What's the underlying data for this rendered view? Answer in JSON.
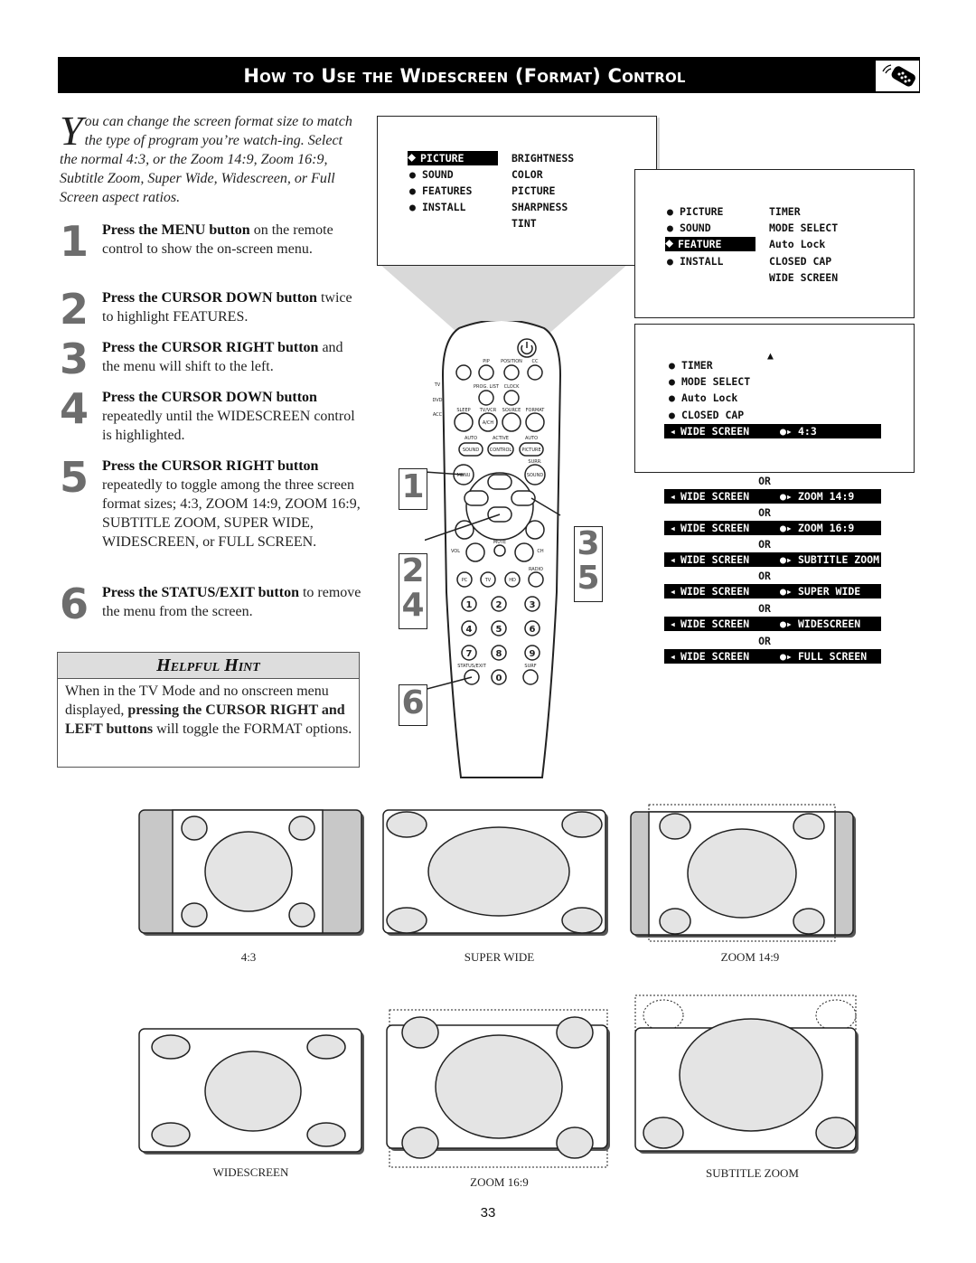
{
  "header": {
    "title": "How to Use the Widescreen (Format) Control",
    "icon": "remote-control-icon"
  },
  "intro": {
    "dropcap": "Y",
    "text": "ou can change the screen format size to match the type of program you’re watch-ing. Select the normal 4:3, or the Zoom 14:9, Zoom 16:9, Subtitle Zoom, Super Wide, Widescreen, or Full Screen aspect ratios."
  },
  "steps": [
    {
      "number": "1",
      "bold": "Press the MENU button",
      "rest": " on the remote control to show the on-screen menu."
    },
    {
      "number": "2",
      "bold": "Press the CURSOR DOWN button",
      "rest": " twice to highlight FEATURES."
    },
    {
      "number": "3",
      "bold": "Press the CURSOR RIGHT button",
      "rest": " and the menu will shift to the left."
    },
    {
      "number": "4",
      "bold": "Press the CURSOR DOWN button",
      "rest": " repeatedly until the WIDESCREEN control is highlighted."
    },
    {
      "number": "5",
      "bold": "Press the CURSOR RIGHT button",
      "rest": " repeatedly to toggle among the three screen format sizes; 4:3, ZOOM 14:9, ZOOM 16:9, SUBTITLE ZOOM, SUPER WIDE, WIDESCREEN, or FULL SCREEN."
    },
    {
      "number": "6",
      "bold": "Press the STATUS/EXIT button",
      "rest": " to remove the menu from the screen."
    }
  ],
  "hint": {
    "title": "Helpful Hint",
    "text_before": "When in the TV Mode and no onscreen menu displayed, ",
    "bold": "pressing the CURSOR RIGHT and LEFT buttons",
    "text_after": " will toggle the FORMAT options."
  },
  "menu1": {
    "left": [
      "PICTURE",
      "SOUND",
      "FEATURES",
      "INSTALL"
    ],
    "right": [
      "BRIGHTNESS",
      "COLOR",
      "PICTURE",
      "SHARPNESS",
      "TINT"
    ],
    "highlighted": "PICTURE"
  },
  "menu2": {
    "left": [
      "PICTURE",
      "SOUND",
      "FEATURE",
      "INSTALL"
    ],
    "right": [
      "TIMER",
      "MODE SELECT",
      "Auto Lock",
      "CLOSED CAP",
      "WIDE SCREEN"
    ],
    "highlighted": "FEATURE"
  },
  "menu3": {
    "items": [
      "TIMER",
      "MODE SELECT",
      "Auto Lock",
      "CLOSED CAP"
    ],
    "selected_label": "WIDE SCREEN",
    "selected_value": "4:3"
  },
  "format_options": {
    "or_label": "OR",
    "row_label": "WIDE SCREEN",
    "values": [
      "ZOOM 14:9",
      "ZOOM 16:9",
      "SUBTITLE ZOOM",
      "SUPER WIDE",
      "WIDESCREEN",
      "FULL SCREEN"
    ]
  },
  "remote": {
    "labels": {
      "pip": "PIP",
      "position": "POSITION",
      "cc": "CC",
      "tv": "TV",
      "dvd": "DVD",
      "acc": "ACC",
      "prog_list": "PROG. LIST",
      "clock": "CLOCK",
      "sleep": "SLEEP",
      "tvvcr": "TV/VCR",
      "source": "SOURCE",
      "format": "FORMAT",
      "ach": "A/CH",
      "auto1": "AUTO",
      "active": "ACTIVE",
      "auto2": "AUTO",
      "sound": "SOUND",
      "control": "CONTROL",
      "picture": "PICTURE",
      "menu": "MENU",
      "surr": "SURR.",
      "surr_sound": "SOUND",
      "vol": "VOL",
      "mute": "MUTE",
      "ch": "CH",
      "radio": "RADIO",
      "pc": "PC",
      "tvbtn": "TV",
      "hd": "HD",
      "status_exit": "STATUS/EXIT",
      "surf": "SURF",
      "digits": [
        "1",
        "2",
        "3",
        "4",
        "5",
        "6",
        "7",
        "8",
        "9",
        "0"
      ]
    },
    "callouts": [
      "1",
      "2",
      "4",
      "3",
      "5",
      "6"
    ]
  },
  "diagrams": [
    {
      "name": "4:3",
      "caption": "4:3"
    },
    {
      "name": "super-wide",
      "caption": "SUPER WIDE"
    },
    {
      "name": "zoom-14-9",
      "caption": "ZOOM 14:9"
    },
    {
      "name": "widescreen",
      "caption": "WIDESCREEN"
    },
    {
      "name": "zoom-16-9",
      "caption": "ZOOM 16:9"
    },
    {
      "name": "subtitle-zoom",
      "caption": "SUBTITLE ZOOM"
    }
  ],
  "page_number": "33",
  "colors": {
    "header_bg": "#000000",
    "step_number": "#6d6d6d",
    "diagram_fill": "#e4e4e4",
    "sidebar_fill": "#c8c8c8",
    "hint_bg": "#dddddd"
  }
}
